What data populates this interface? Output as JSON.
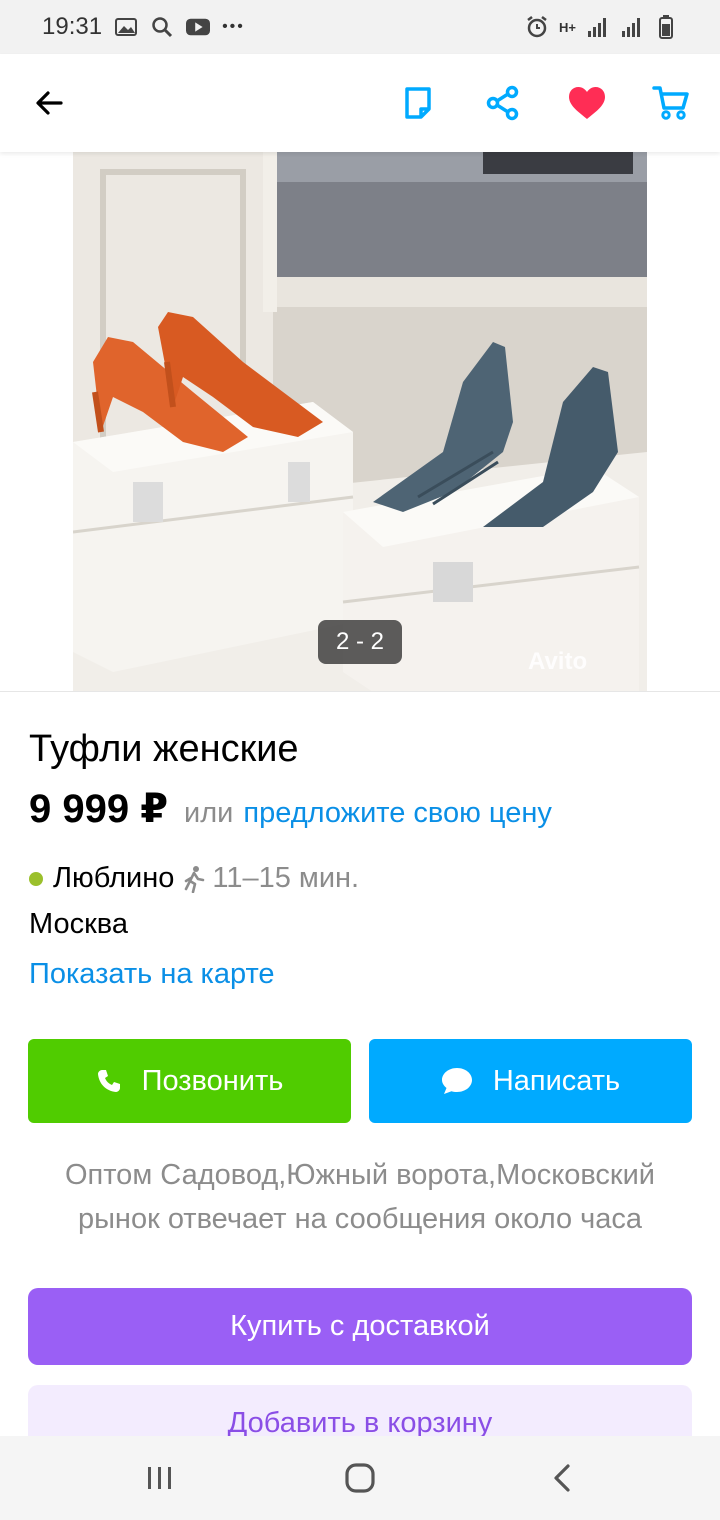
{
  "status_bar": {
    "time": "19:31",
    "dots": "•••",
    "network_label": "H+",
    "icons": [
      "image-icon",
      "search-icon",
      "youtube-icon",
      "alarm-icon",
      "signal-icon",
      "signal-icon",
      "battery-icon"
    ]
  },
  "toolbar": {
    "icons": [
      "back-arrow-icon",
      "note-icon",
      "share-icon",
      "heart-icon",
      "cart-icon"
    ],
    "colors": {
      "accent": "#00aaff",
      "favorite": "#ff2d55"
    }
  },
  "gallery": {
    "counter": "2 - 2",
    "watermark": "Avito"
  },
  "listing": {
    "title": "Туфли женские",
    "price": "9 999 ₽",
    "price_or": "или",
    "price_offer": "предложите свою цену",
    "metro": "Люблино",
    "walk_time": "11–15 мин.",
    "city": "Москва",
    "map_link": "Показать на карте"
  },
  "actions": {
    "call_label": "Позвонить",
    "write_label": "Написать",
    "buy_label": "Купить с доставкой",
    "cart_label": "Добавить в корзину",
    "colors": {
      "call": "#50cc00",
      "write": "#00aaff",
      "buy": "#9a5ff5"
    }
  },
  "seller": {
    "line1": "Оптом Садовод,Южный ворота,Московский",
    "line2": "рынок отвечает на сообщения около часа"
  },
  "nav_bar": {
    "icons": [
      "recent-apps-icon",
      "home-icon",
      "back-icon"
    ]
  }
}
